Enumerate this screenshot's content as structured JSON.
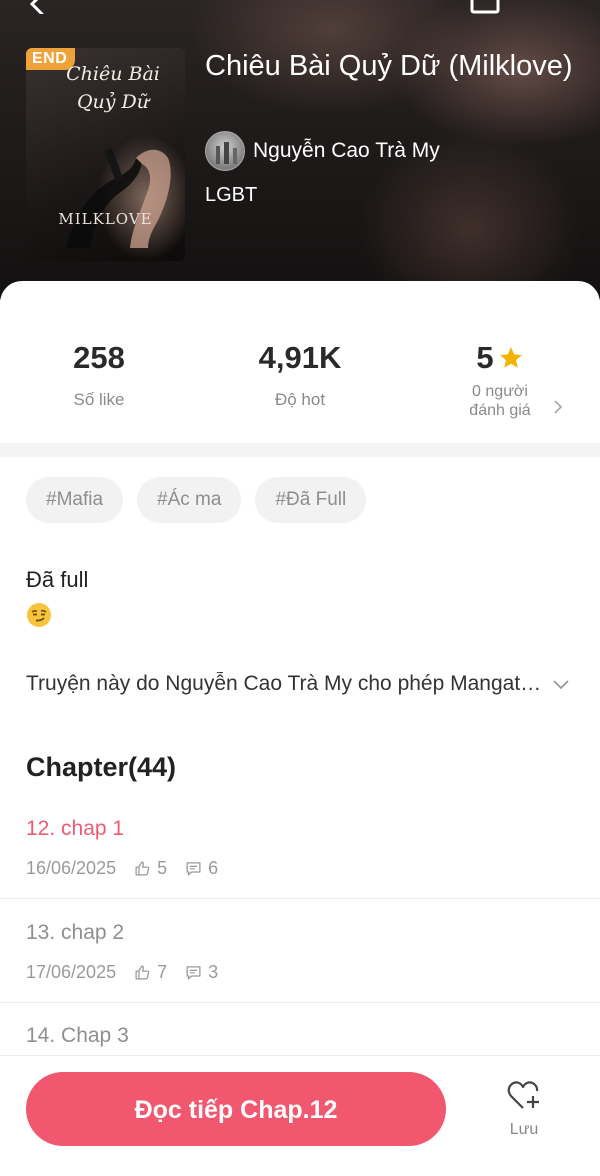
{
  "book": {
    "badge": "END",
    "cover_script": "Chiêu Bài Quỷ Dữ",
    "cover_penname": "MILKLOVE",
    "title": "Chiêu Bài Quỷ Dữ (Milklove)",
    "author": "Nguyễn Cao Trà My",
    "genre": "LGBT"
  },
  "stats": {
    "likes_value": "258",
    "likes_label": "Số like",
    "hot_value": "4,91K",
    "hot_label": "Độ hot",
    "rating_value": "5",
    "rating_label_line1": "0 người",
    "rating_label_line2": "đánh giá"
  },
  "tags": [
    "#Mafia",
    "#Ác ma",
    "#Đã Full"
  ],
  "status_text": "Đã full",
  "description": "Truyện này do Nguyễn Cao Trà My cho phép Mangatoon đăng tải",
  "chapters_heading": "Chapter(44)",
  "chapters": [
    {
      "title": "12. chap 1",
      "date": "16/06/2025",
      "likes": "5",
      "comments": "6"
    },
    {
      "title": "13. chap 2",
      "date": "17/06/2025",
      "likes": "7",
      "comments": "3"
    },
    {
      "title": "14. Chap 3"
    }
  ],
  "bottom": {
    "read_label": "Đọc tiếp Chap.12",
    "save_label": "Lưu"
  },
  "colors": {
    "accent": "#f1576e",
    "active_chapter": "#ef5a72",
    "star": "#f5b301",
    "badge": "#f0a23a"
  },
  "icons": {
    "back": "chevron-left-icon",
    "share": "share-icon",
    "star": "star-icon",
    "chevron_right": "chevron-right-icon",
    "expand": "chevron-down-icon",
    "like": "thumb-up-icon",
    "comment": "comment-icon",
    "save": "heart-plus-icon",
    "emoji": "smirk-emoji-icon"
  }
}
